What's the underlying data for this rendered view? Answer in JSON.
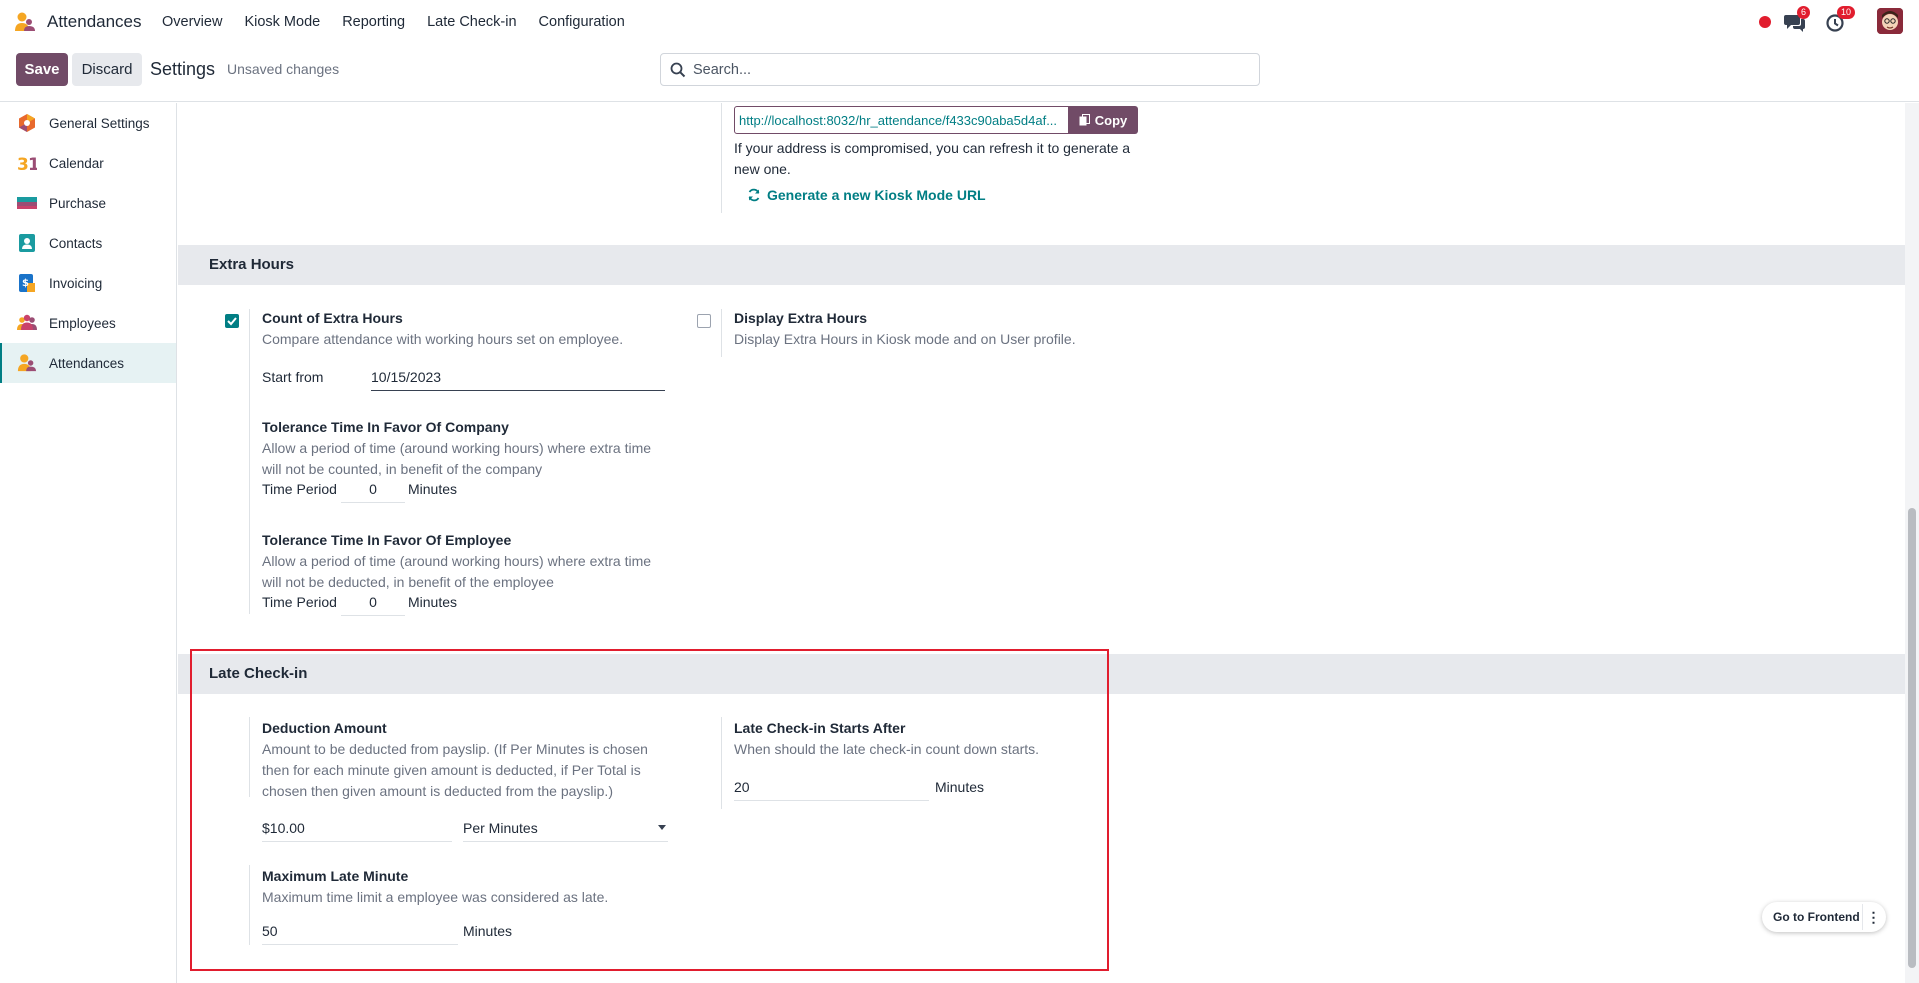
{
  "navbar": {
    "app_name": "Attendances",
    "menu": [
      "Overview",
      "Kiosk Mode",
      "Reporting",
      "Late Check-in",
      "Configuration"
    ],
    "chat_badge": "6",
    "activity_badge": "10"
  },
  "controlbar": {
    "save_label": "Save",
    "discard_label": "Discard",
    "title": "Settings",
    "status": "Unsaved changes",
    "search_placeholder": "Search..."
  },
  "sidebar": {
    "items": [
      {
        "label": "General Settings",
        "icon": "general-settings-icon"
      },
      {
        "label": "Calendar",
        "icon": "calendar-icon"
      },
      {
        "label": "Purchase",
        "icon": "purchase-icon"
      },
      {
        "label": "Contacts",
        "icon": "contacts-icon"
      },
      {
        "label": "Invoicing",
        "icon": "invoicing-icon"
      },
      {
        "label": "Employees",
        "icon": "employees-icon"
      },
      {
        "label": "Attendances",
        "icon": "attendances-icon"
      }
    ],
    "active": "Attendances"
  },
  "kiosk": {
    "url": "http://localhost:8032/hr_attendance/f433c90aba5d4af...",
    "copy_label": "Copy",
    "refresh_note": "If your address is compromised, you can refresh it to generate a new one.",
    "generate_link": "Generate a new Kiosk Mode URL"
  },
  "extra_hours": {
    "section_title": "Extra Hours",
    "count": {
      "title": "Count of Extra Hours",
      "desc": "Compare attendance with working hours set on employee.",
      "checked": true,
      "start_label": "Start from",
      "start_value": "10/15/2023"
    },
    "tolerance_company": {
      "title": "Tolerance Time In Favor Of Company",
      "desc": "Allow a period of time (around working hours) where extra time will not be counted, in benefit of the company",
      "period_label": "Time Period",
      "value": "0",
      "unit": "Minutes"
    },
    "tolerance_employee": {
      "title": "Tolerance Time In Favor Of Employee",
      "desc": "Allow a period of time (around working hours) where extra time will not be deducted, in benefit of the employee",
      "period_label": "Time Period",
      "value": "0",
      "unit": "Minutes"
    },
    "display": {
      "title": "Display Extra Hours",
      "desc": "Display Extra Hours in Kiosk mode and on User profile.",
      "checked": false
    }
  },
  "late_checkin": {
    "section_title": "Late Check-in",
    "deduction": {
      "title": "Deduction Amount",
      "desc": "Amount to be deducted from payslip. (If Per Minutes is chosen then for each minute given amount is deducted, if Per Total is chosen then given amount is deducted from the payslip.)",
      "amount": "$10.00",
      "mode": "Per Minutes"
    },
    "starts_after": {
      "title": "Late Check-in Starts After",
      "desc": "When should the late check-in count down starts.",
      "value": "20",
      "unit": "Minutes"
    },
    "max_late": {
      "title": "Maximum Late Minute",
      "desc": "Maximum time limit a employee was considered as late.",
      "value": "50",
      "unit": "Minutes"
    }
  },
  "frontend_button": "Go to Frontend",
  "colors": {
    "primary": "#714B67",
    "teal": "#017e84",
    "highlight": "#e11d2e",
    "section_bg": "#e7e9ed"
  }
}
